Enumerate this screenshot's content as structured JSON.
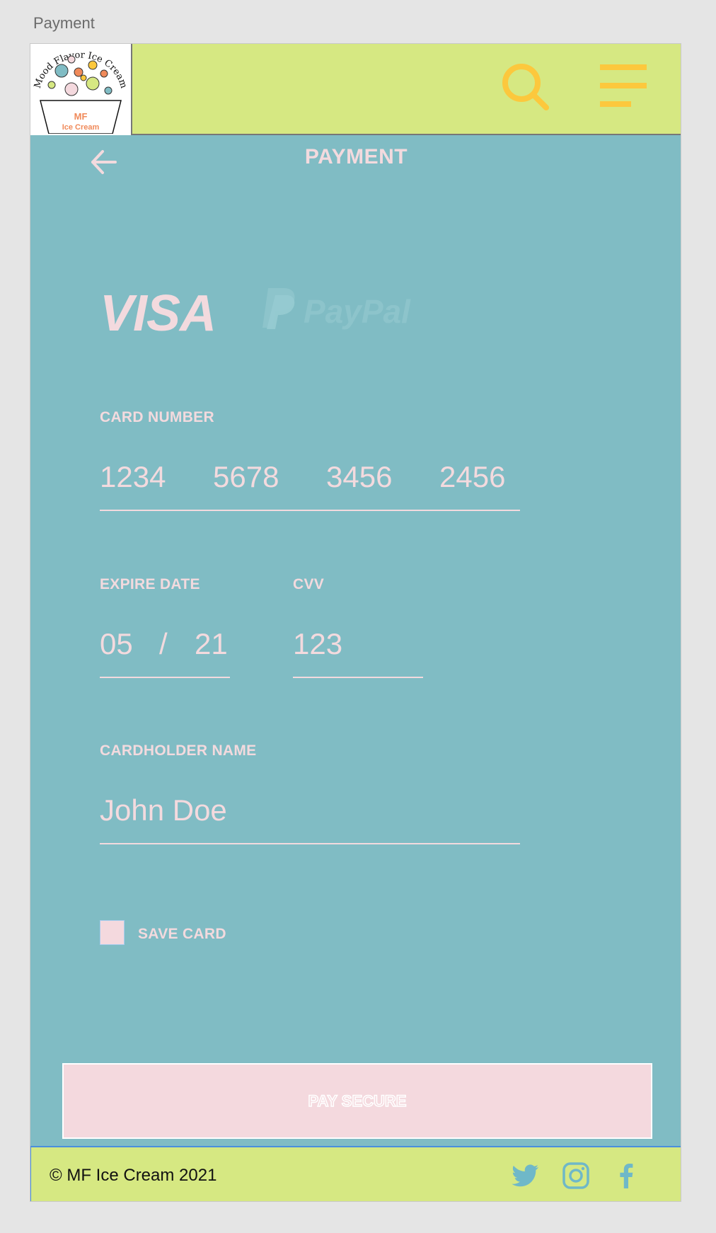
{
  "artboard_label": "Payment",
  "header": {
    "logo": {
      "arc_text": "Mood Flavor Ice Cream",
      "initials": "MF",
      "subtitle": "Ice Cream"
    }
  },
  "page": {
    "title": "PAYMENT"
  },
  "payment_methods": {
    "visa": "VISA",
    "paypal": "PayPal"
  },
  "form": {
    "card_number": {
      "label": "CARD NUMBER",
      "groups": [
        "1234",
        "5678",
        "3456",
        "2456"
      ]
    },
    "expire_date": {
      "label": "EXPIRE DATE",
      "month": "05",
      "separator": "/",
      "year": "21"
    },
    "cvv": {
      "label": "CVV",
      "value": "123"
    },
    "cardholder": {
      "label": "CARDHOLDER NAME",
      "value": "John Doe"
    },
    "save_card": {
      "label": "SAVE CARD",
      "checked": false
    }
  },
  "pay_button": {
    "label": "PAY SECURE"
  },
  "footer": {
    "copyright": "© MF Ice Cream 2021",
    "social": [
      "twitter-icon",
      "instagram-icon",
      "facebook-icon"
    ]
  },
  "colors": {
    "background": "#80bcc4",
    "header": "#d6e882",
    "accent_yellow": "#fcc83d",
    "text_pink": "#f3dade",
    "button_pink": "#f4d9de",
    "footer_border": "#4a8fdc",
    "social_blue": "#6fb8c8"
  }
}
